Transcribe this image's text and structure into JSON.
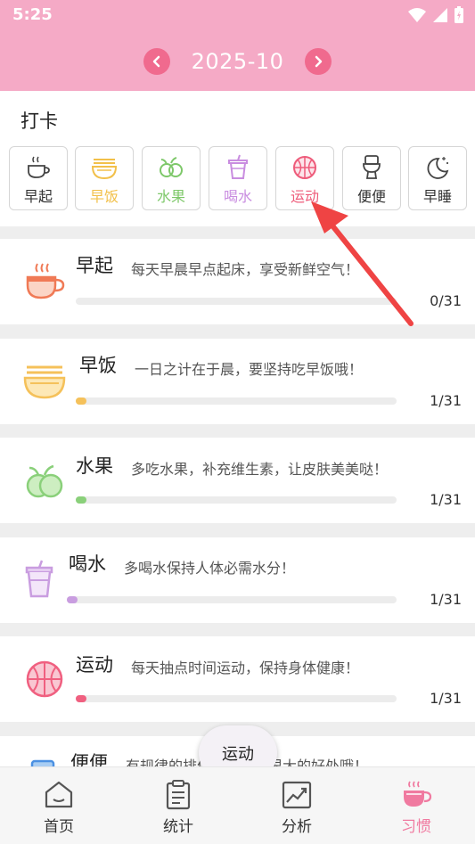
{
  "status_bar": {
    "time": "5:25"
  },
  "header": {
    "month": "2025-10"
  },
  "checkin": {
    "title": "打卡",
    "chips": [
      {
        "label": "早起",
        "icon": "cup-icon",
        "color": "#333333"
      },
      {
        "label": "早饭",
        "icon": "noodle-bowl-icon",
        "color": "#f2c04a"
      },
      {
        "label": "水果",
        "icon": "fruit-icon",
        "color": "#7ec86a"
      },
      {
        "label": "喝水",
        "icon": "drink-cup-icon",
        "color": "#c98de0"
      },
      {
        "label": "运动",
        "icon": "ball-icon",
        "color": "#ee5b7a"
      },
      {
        "label": "便便",
        "icon": "toilet-icon",
        "color": "#333333"
      },
      {
        "label": "早睡",
        "icon": "moon-icon",
        "color": "#333333"
      }
    ]
  },
  "habits": [
    {
      "name": "早起",
      "desc": "每天早晨早点起床，享受新鲜空气！",
      "count": "0/31",
      "progress": 0.0,
      "color": "#f07a56",
      "icon": "coffee-cup-icon"
    },
    {
      "name": "早饭",
      "desc": "一日之计在于晨，要坚持吃早饭哦！",
      "count": "1/31",
      "progress": 0.032,
      "color": "#f5c15a",
      "icon": "noodle-bowl-icon"
    },
    {
      "name": "水果",
      "desc": "多吃水果，补充维生素，让皮肤美美哒！",
      "count": "1/31",
      "progress": 0.032,
      "color": "#8ad07a",
      "icon": "fruit-icon"
    },
    {
      "name": "喝水",
      "desc": "多喝水保持人体必需水分！",
      "count": "1/31",
      "progress": 0.032,
      "color": "#c99de0",
      "icon": "drink-cup-icon"
    },
    {
      "name": "运动",
      "desc": "每天抽点时间运动，保持身体健康！",
      "count": "1/31",
      "progress": 0.032,
      "color": "#f06080",
      "icon": "ball-icon"
    },
    {
      "name": "便便",
      "desc": "有规律的排便对身体有很大的好处哦！",
      "count": "",
      "progress": 0.0,
      "color": "#4a90e2",
      "icon": "toilet-icon"
    }
  ],
  "fab": {
    "label": "运动"
  },
  "bottom_nav": [
    {
      "label": "首页",
      "icon": "home-icon",
      "active": false
    },
    {
      "label": "统计",
      "icon": "clipboard-icon",
      "active": false
    },
    {
      "label": "分析",
      "icon": "chart-icon",
      "active": false
    },
    {
      "label": "习惯",
      "icon": "coffee-cup-icon",
      "active": true
    }
  ],
  "colors": {
    "header_bg": "#f5aac6",
    "accent": "#f06a8e",
    "active_nav": "#f07aa0"
  }
}
